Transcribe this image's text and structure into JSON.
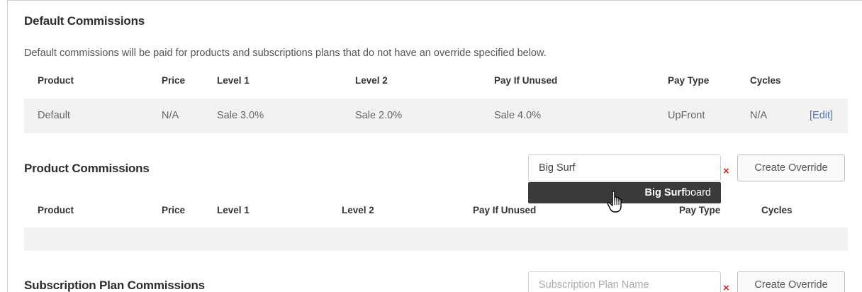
{
  "default_commissions": {
    "title": "Default Commissions",
    "description": "Default commissions will be paid for products and subscriptions plans that do not have an override specified below.",
    "headers": [
      "Product",
      "Price",
      "Level 1",
      "Level 2",
      "Pay If Unused",
      "Pay Type",
      "Cycles"
    ],
    "row": {
      "product": "Default",
      "price": "N/A",
      "level1": "Sale 3.0%",
      "level2": "Sale 2.0%",
      "pay_if_unused": "Sale 4.0%",
      "pay_type": "UpFront",
      "cycles": "N/A",
      "edit_label": "[Edit]"
    }
  },
  "product_commissions": {
    "title": "Product Commissions",
    "search_value": "Big Surf",
    "clear_icon": "×",
    "create_button": "Create Override",
    "suggestion": {
      "match": "Big Surf",
      "rest": "board"
    },
    "headers": [
      "Product",
      "Price",
      "Level 1",
      "Level 2",
      "Pay If Unused",
      "Pay Type",
      "Cycles"
    ]
  },
  "subscription_commissions": {
    "title": "Subscription Plan Commissions",
    "search_placeholder": "Subscription Plan Name",
    "clear_icon": "×",
    "create_button": "Create Override"
  },
  "colors": {
    "accent_link": "#4a78c2",
    "clear_red": "#d9261c",
    "suggest_bg": "#3a3a3a",
    "row_bg": "#f2f2f2"
  },
  "icons": {
    "cursor": "hand-pointer-icon"
  }
}
